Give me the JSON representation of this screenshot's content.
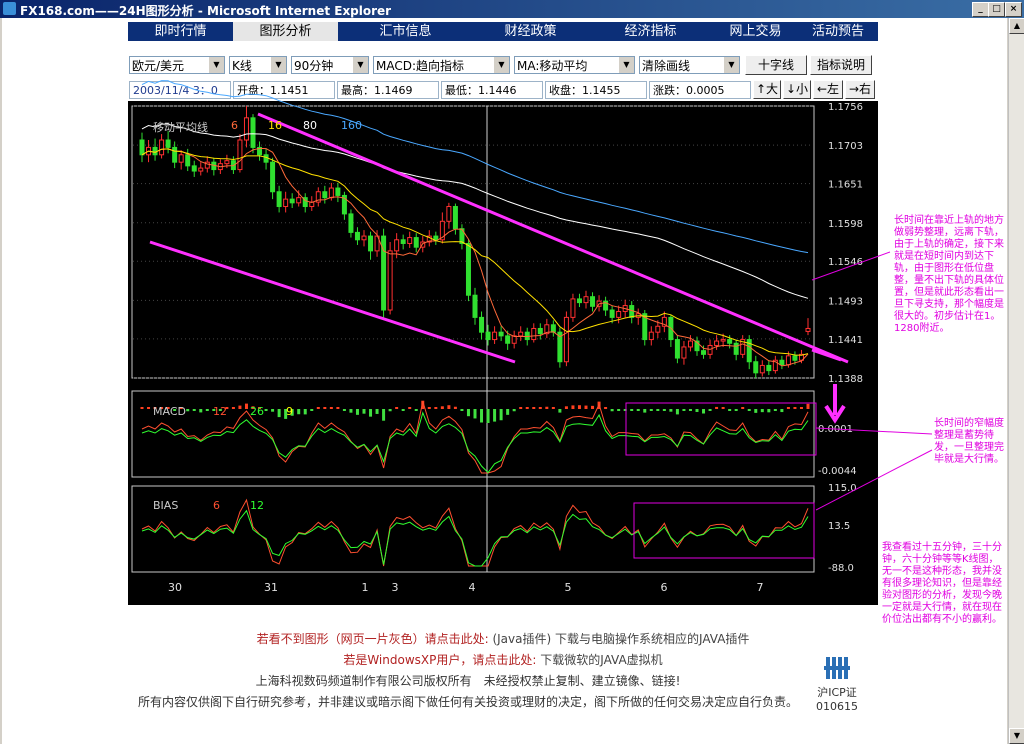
{
  "window": {
    "title": "FX168.com——24H图形分析 - Microsoft Internet Explorer"
  },
  "nav": {
    "tabs": [
      "即时行情",
      "图形分析",
      "汇市信息",
      "财经政策",
      "经济指标",
      "网上交易",
      "活动预告"
    ]
  },
  "controls": {
    "pair": "欧元/美元",
    "chart_type": "K线",
    "period": "90分钟",
    "indicator1": "MACD:趋向指标",
    "indicator2": "MA:移动平均",
    "draw": "清除画线",
    "crosshair_btn": "十字线",
    "help_btn": "指标说明",
    "zoom_in": "↑大",
    "zoom_out": "↓小",
    "left": "←左",
    "right": "→右"
  },
  "info": {
    "datetime": "2003/11/4 3：0",
    "open": "开盘：1.1451",
    "high": "最高：1.1469",
    "low": "最低：1.1446",
    "close": "收盘：1.1455",
    "change": "涨跌：0.0005"
  },
  "chart_data": [
    {
      "type": "candlestick",
      "title": "移动平均线",
      "legend": [
        {
          "name": "6",
          "color": "#ff6a3a"
        },
        {
          "name": "16",
          "color": "#ffe000"
        },
        {
          "name": "80",
          "color": "#ffffff"
        },
        {
          "name": "160",
          "color": "#4aa8ff"
        }
      ],
      "y_ticks": [
        "1.1756",
        "1.1703",
        "1.1651",
        "1.1598",
        "1.1546",
        "1.1493",
        "1.1441",
        "1.1388"
      ],
      "ylim": [
        1.1388,
        1.1756
      ],
      "x_ticks": [
        "30",
        "31",
        "1",
        "3",
        "4",
        "5",
        "6",
        "7"
      ],
      "candles": [
        [
          1.171,
          1.169,
          1.172,
          1.168
        ],
        [
          1.169,
          1.17,
          1.171,
          1.168
        ],
        [
          1.17,
          1.169,
          1.1712,
          1.1682
        ],
        [
          1.169,
          1.171,
          1.1718,
          1.1685
        ],
        [
          1.171,
          1.17,
          1.1722,
          1.1692
        ],
        [
          1.17,
          1.168,
          1.1708,
          1.1672
        ],
        [
          1.168,
          1.169,
          1.1696,
          1.167
        ],
        [
          1.169,
          1.1675,
          1.1698,
          1.1668
        ],
        [
          1.1675,
          1.1668,
          1.1682,
          1.166
        ],
        [
          1.1668,
          1.1672,
          1.168,
          1.1662
        ],
        [
          1.1672,
          1.168,
          1.1688,
          1.1666
        ],
        [
          1.168,
          1.167,
          1.1686,
          1.1662
        ],
        [
          1.167,
          1.1678,
          1.1684,
          1.1664
        ],
        [
          1.1678,
          1.1682,
          1.169,
          1.1672
        ],
        [
          1.1682,
          1.167,
          1.1688,
          1.1664
        ],
        [
          1.167,
          1.171,
          1.1718,
          1.1666
        ],
        [
          1.171,
          1.174,
          1.1756,
          1.17
        ],
        [
          1.174,
          1.17,
          1.1745,
          1.1692
        ],
        [
          1.17,
          1.169,
          1.1708,
          1.1682
        ],
        [
          1.169,
          1.168,
          1.1698,
          1.167
        ],
        [
          1.168,
          1.164,
          1.1686,
          1.163
        ],
        [
          1.164,
          1.162,
          1.1648,
          1.1612
        ],
        [
          1.162,
          1.163,
          1.164,
          1.1612
        ],
        [
          1.163,
          1.1625,
          1.1638,
          1.1618
        ],
        [
          1.1625,
          1.1632,
          1.1642,
          1.162
        ],
        [
          1.1632,
          1.162,
          1.1638,
          1.1612
        ],
        [
          1.162,
          1.1626,
          1.1634,
          1.1614
        ],
        [
          1.1626,
          1.164,
          1.1646,
          1.162
        ],
        [
          1.164,
          1.1632,
          1.1648,
          1.1624
        ],
        [
          1.1632,
          1.1645,
          1.1652,
          1.1628
        ],
        [
          1.1645,
          1.1635,
          1.1652,
          1.1626
        ],
        [
          1.1635,
          1.161,
          1.164,
          1.1602
        ],
        [
          1.161,
          1.1585,
          1.1616,
          1.1578
        ],
        [
          1.1585,
          1.1575,
          1.1592,
          1.1568
        ],
        [
          1.1575,
          1.158,
          1.1588,
          1.1566
        ],
        [
          1.158,
          1.156,
          1.1586,
          1.1548
        ],
        [
          1.156,
          1.158,
          1.1588,
          1.1552
        ],
        [
          1.158,
          1.148,
          1.159,
          1.147
        ],
        [
          1.148,
          1.156,
          1.1572,
          1.1474
        ],
        [
          1.156,
          1.1575,
          1.1584,
          1.155
        ],
        [
          1.1575,
          1.157,
          1.1582,
          1.1562
        ],
        [
          1.157,
          1.1578,
          1.1586,
          1.1564
        ],
        [
          1.1578,
          1.1565,
          1.1584,
          1.1558
        ],
        [
          1.1565,
          1.1572,
          1.158,
          1.1558
        ],
        [
          1.1572,
          1.158,
          1.1588,
          1.1566
        ],
        [
          1.158,
          1.1575,
          1.1586,
          1.1568
        ],
        [
          1.1575,
          1.16,
          1.1612,
          1.157
        ],
        [
          1.16,
          1.162,
          1.1625,
          1.159
        ],
        [
          1.162,
          1.159,
          1.1624,
          1.1582
        ],
        [
          1.159,
          1.157,
          1.1596,
          1.1562
        ],
        [
          1.157,
          1.15,
          1.1576,
          1.1492
        ],
        [
          1.15,
          1.147,
          1.151,
          1.146
        ],
        [
          1.147,
          1.145,
          1.1478,
          1.144
        ],
        [
          1.145,
          1.144,
          1.146,
          1.1432
        ],
        [
          1.144,
          1.145,
          1.1458,
          1.1434
        ],
        [
          1.145,
          1.1445,
          1.1458,
          1.1438
        ],
        [
          1.1445,
          1.1435,
          1.1452,
          1.1426
        ],
        [
          1.1435,
          1.1445,
          1.1452,
          1.1428
        ],
        [
          1.1445,
          1.145,
          1.1458,
          1.1438
        ],
        [
          1.145,
          1.144,
          1.1456,
          1.1432
        ],
        [
          1.144,
          1.1455,
          1.1462,
          1.1436
        ],
        [
          1.1455,
          1.1448,
          1.1462,
          1.144
        ],
        [
          1.1448,
          1.146,
          1.1468,
          1.1442
        ],
        [
          1.146,
          1.145,
          1.1466,
          1.1444
        ],
        [
          1.145,
          1.141,
          1.1456,
          1.1402
        ],
        [
          1.141,
          1.147,
          1.1478,
          1.1404
        ],
        [
          1.147,
          1.1495,
          1.1502,
          1.1464
        ],
        [
          1.1495,
          1.149,
          1.1502,
          1.1484
        ],
        [
          1.149,
          1.1498,
          1.1506,
          1.1482
        ],
        [
          1.1498,
          1.1485,
          1.1504,
          1.1478
        ],
        [
          1.1485,
          1.1492,
          1.15,
          1.1478
        ],
        [
          1.1492,
          1.148,
          1.1498,
          1.1472
        ],
        [
          1.148,
          1.147,
          1.1486,
          1.1462
        ],
        [
          1.147,
          1.1478,
          1.1486,
          1.1462
        ],
        [
          1.1478,
          1.1486,
          1.1494,
          1.147
        ],
        [
          1.1486,
          1.147,
          1.1492,
          1.1462
        ],
        [
          1.147,
          1.1475,
          1.1482,
          1.146
        ],
        [
          1.1475,
          1.144,
          1.148,
          1.1432
        ],
        [
          1.144,
          1.145,
          1.1458,
          1.1432
        ],
        [
          1.145,
          1.1458,
          1.1466,
          1.1442
        ],
        [
          1.1458,
          1.147,
          1.1478,
          1.145
        ],
        [
          1.147,
          1.144,
          1.1474,
          1.143
        ],
        [
          1.144,
          1.1415,
          1.1446,
          1.1408
        ],
        [
          1.1415,
          1.143,
          1.1438,
          1.1406
        ],
        [
          1.143,
          1.1438,
          1.1446,
          1.1424
        ],
        [
          1.1438,
          1.1425,
          1.1444,
          1.1418
        ],
        [
          1.1425,
          1.142,
          1.1432,
          1.1414
        ],
        [
          1.142,
          1.1432,
          1.144,
          1.1414
        ],
        [
          1.1432,
          1.1438,
          1.1446,
          1.1426
        ],
        [
          1.1438,
          1.144,
          1.1448,
          1.143
        ],
        [
          1.144,
          1.1435,
          1.1446,
          1.1428
        ],
        [
          1.1435,
          1.142,
          1.144,
          1.1412
        ],
        [
          1.142,
          1.144,
          1.1446,
          1.1415
        ],
        [
          1.144,
          1.141,
          1.1446,
          1.14
        ],
        [
          1.141,
          1.1395,
          1.1418,
          1.1388
        ],
        [
          1.1395,
          1.1405,
          1.1412,
          1.139
        ],
        [
          1.1405,
          1.1398,
          1.1412,
          1.1392
        ],
        [
          1.1398,
          1.1412,
          1.1418,
          1.1394
        ],
        [
          1.1412,
          1.1406,
          1.1418,
          1.14
        ],
        [
          1.1406,
          1.1418,
          1.1424,
          1.1402
        ],
        [
          1.1418,
          1.1412,
          1.1424,
          1.1406
        ],
        [
          1.1412,
          1.142,
          1.1426,
          1.1408
        ],
        [
          1.1451,
          1.1455,
          1.1469,
          1.1446
        ]
      ]
    },
    {
      "type": "bar",
      "title": "MACD",
      "legend": [
        {
          "name": "12",
          "color": "#ff5030"
        },
        {
          "name": "26",
          "color": "#30ff30"
        },
        {
          "name": "9",
          "color": "#ffff00"
        }
      ],
      "y_ticks": [
        "0.0001",
        "-0.0044"
      ]
    },
    {
      "type": "line",
      "title": "BIAS",
      "legend": [
        {
          "name": "6",
          "color": "#ff5030"
        },
        {
          "name": "12",
          "color": "#30ff30"
        }
      ],
      "y_ticks": [
        "115.0",
        "13.5",
        "-88.0"
      ]
    }
  ],
  "annotations": {
    "note1": "长时间在靠近上轨的地方做弱势整理，远离下轨，由于上轨的确定，接下来就是在短时间内到达下轨，由于图形在低位盘整，量不出下轨的具体位置，但是就此形态看出一旦下寻支持，那个幅度是很大的。初步估计在1。1280附近。",
    "note2": "长时间的窄幅度整理是蓄势待发，一旦整理完毕就是大行情。",
    "note3": "我查看过十五分钟，三十分钟，六十分钟等等K线图，无一不是这种形态，我并没有很多理论知识，但是靠经验对图形的分析，发现今晚一定就是大行情，就在现在价位沽出都有不小的赢利。"
  },
  "footer": {
    "line1a": "若看不到图形（网页一片灰色）请点击此处:",
    "line1b": "(Java插件)",
    "line1c": "下载与电脑操作系统相应的JAVA插件",
    "line2a": "若是WindowsXP用户，请点击此处:",
    "line2b": "下载微软的JAVA虚拟机",
    "line3": "上海科视数码频道制作有限公司版权所有　未经授权禁止复制、建立镜像、链接!",
    "line4": "所有内容仅供阁下自行研究参考，并非建议或暗示阁下做任何有关投资或理财的决定，阁下所做的任何交易决定应自行负责。",
    "icp_label": "沪ICP证",
    "icp_num": "010615"
  },
  "colors": {
    "nav_bg": "#0c2f78",
    "chart_bg": "#000000",
    "annotation": "#e000e0",
    "up": "#ff3030",
    "down": "#30e030"
  }
}
